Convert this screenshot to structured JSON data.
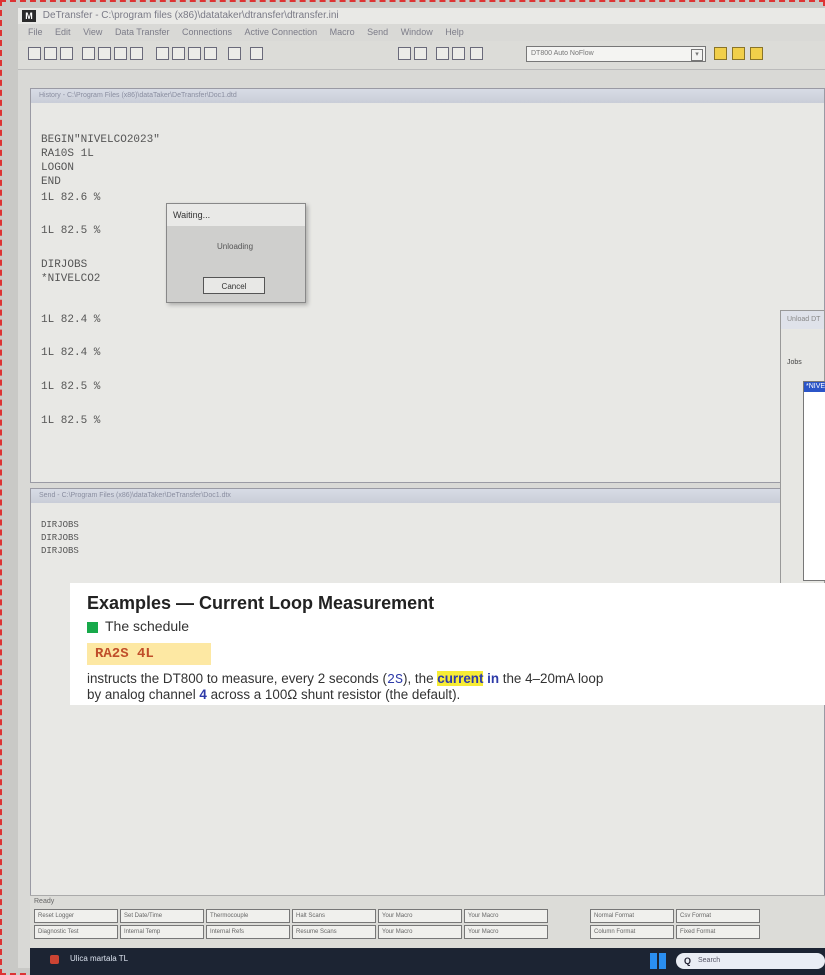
{
  "window": {
    "title": "DeTransfer - C:\\program files (x86)\\datataker\\dtransfer\\dtransfer.ini",
    "menu": [
      "File",
      "Edit",
      "View",
      "Data Transfer",
      "Connections",
      "Active Connection",
      "Macro",
      "Send",
      "Window",
      "Help"
    ]
  },
  "toolbar": {
    "connection_select": "DT800 Auto NoFlow"
  },
  "history_window": {
    "title": "History - C:\\Program Files (x86)\\dataTaker\\DeTransfer\\Doc1.dtd",
    "lines": [
      "BEGIN\"NIVELCO2023\"",
      "RA10S 1L",
      "LOGON",
      "END",
      "1L 82.6 %",
      "1L 82.5 %",
      "DIRJOBS",
      " *NIVELCO2",
      "1L 82.4 %",
      "1L 82.4 %",
      "1L 82.5 %",
      "1L 82.5 %"
    ]
  },
  "waiting_dialog": {
    "title": "Waiting...",
    "message": "Unloading",
    "cancel_label": "Cancel"
  },
  "unload_panel": {
    "title": "Unload DT",
    "jobs_label": "Jobs",
    "selected_job": "*NIVELCO"
  },
  "send_window": {
    "title": "Send - C:\\Program Files (x86)\\dataTaker\\DeTransfer\\Doc1.dtx",
    "lines": [
      "DIRJOBS",
      "DIRJOBS",
      "DIRJOBS"
    ]
  },
  "overlay": {
    "heading": "Examples — Current Loop Measurement",
    "schedule_label": "The schedule",
    "code": "RA2S 4L",
    "para1_a": "instructs the DT800 to measure, every 2 seconds (",
    "para1_code": "2S",
    "para1_b": "), the ",
    "para1_hl1": "current",
    "para1_space": " ",
    "para1_hl2": "in",
    "para1_c": " the 4–20mA loop",
    "para2_a": "by analog channel ",
    "para2_num": "4",
    "para2_b": " across a 100Ω shunt resistor (the default)."
  },
  "status": {
    "ready": "Ready",
    "buttons_row1": [
      "Reset Logger",
      "Set Date/Time",
      "Thermocouple",
      "Halt Scans",
      "Your Macro",
      "Your Macro",
      "Normal Format",
      "Csv Format"
    ],
    "buttons_row2": [
      "Diagnostic Test",
      "Internal Temp",
      "Internal Refs",
      "Resume Scans",
      "Your Macro",
      "Your Macro",
      "Column Format",
      "Fixed Format"
    ]
  },
  "taskbar": {
    "app_label": "Ulica martala TL",
    "search_placeholder": "Search"
  },
  "colors": {
    "code_highlight_bg": "#fde8a3",
    "code_text": "#c04e2a",
    "current_highlight": "#f7ec35",
    "accent_blue": "#2d3aa8",
    "schedule_bullet": "#17a94a"
  }
}
